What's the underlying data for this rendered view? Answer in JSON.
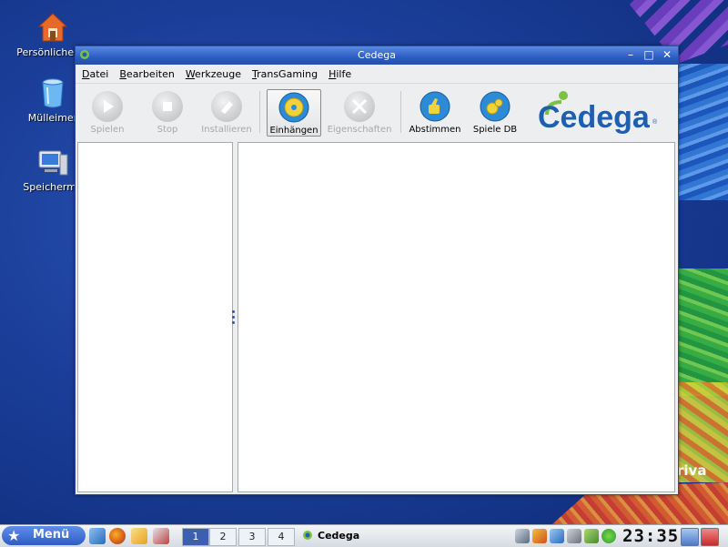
{
  "desktop": {
    "icons": [
      {
        "label": "Persönlicher O",
        "icon": "home-folder-icon"
      },
      {
        "label": "Mülleimer",
        "icon": "trash-icon"
      },
      {
        "label": "Speicherme",
        "icon": "computer-icon"
      }
    ],
    "brand_text": "riva"
  },
  "window": {
    "title": "Cedega",
    "controls": {
      "minimize": "–",
      "maximize": "□",
      "close": "✕"
    },
    "menu": [
      {
        "accel": "D",
        "rest": "atei"
      },
      {
        "accel": "B",
        "rest": "earbeiten"
      },
      {
        "accel": "W",
        "rest": "erkzeuge"
      },
      {
        "accel": "T",
        "rest": "ransGaming"
      },
      {
        "accel": "H",
        "rest": "ilfe"
      }
    ],
    "toolbar": {
      "spielen": "Spielen",
      "stop": "Stop",
      "installieren": "Installieren",
      "einhaengen": "Einhängen",
      "eigenschaften": "Eigenschaften",
      "abstimmen": "Abstimmen",
      "spiele_db": "Spiele DB"
    },
    "logo_text": "Cedega",
    "colors": {
      "title_bar": "#2c5cc4",
      "logo_green": "#7bc242",
      "logo_blue": "#1f5fb0"
    }
  },
  "taskbar": {
    "menu_label": "Menü",
    "desktops": [
      "1",
      "2",
      "3",
      "4"
    ],
    "active_desktop": "1",
    "task": "Cedega",
    "clock": "23:35"
  }
}
